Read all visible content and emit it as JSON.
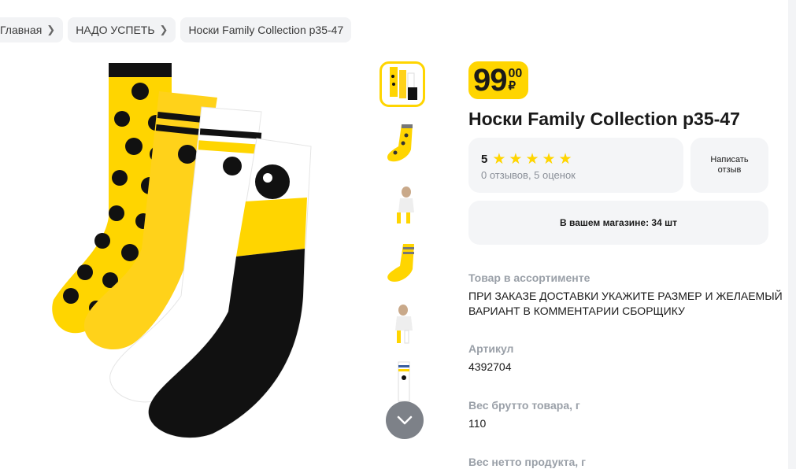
{
  "breadcrumbs": [
    {
      "label": "Главная"
    },
    {
      "label": "НАДО УСПЕТЬ"
    },
    {
      "label": "Носки Family Collection р35-47"
    }
  ],
  "product": {
    "title": "Носки Family Collection р35-47",
    "price": {
      "integer": "99",
      "fraction": "00",
      "currency": "₽"
    },
    "rating": {
      "value": "5",
      "stars": 5,
      "summary": "0 отзывов, 5 оценок"
    },
    "review_button": "Написать отзыв",
    "store_stock": "В вашем магазине: 34 шт"
  },
  "specs": [
    {
      "label": "Товар в ассортименте",
      "value": "ПРИ ЗАКАЗЕ ДОСТАВКИ УКАЖИТЕ РАЗМЕР И ЖЕЛАЕМЫЙ ВАРИАНТ В КОММЕНТАРИИ СБОРЩИКУ"
    },
    {
      "label": "Артикул",
      "value": "4392704"
    },
    {
      "label": "Вес брутто товара, г",
      "value": "110"
    },
    {
      "label": "Вес нетто продукта, г",
      "value": ""
    }
  ],
  "colors": {
    "accent": "#ffd500",
    "card": "#f4f5f7",
    "muted": "#9aa0a8"
  }
}
